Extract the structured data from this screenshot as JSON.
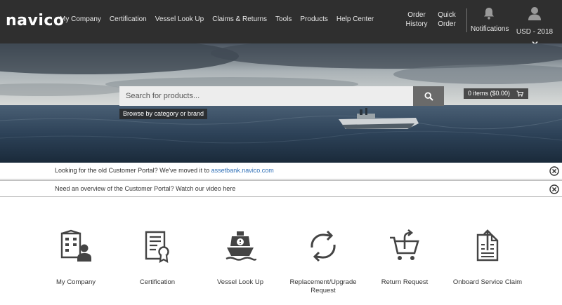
{
  "header": {
    "logo": "navico",
    "nav": [
      "My Company",
      "Certification",
      "Vessel Look Up",
      "Claims & Returns",
      "Tools",
      "Products",
      "Help Center"
    ],
    "order_history": "Order History",
    "quick_order": "Quick Order",
    "notifications": "Notifications",
    "currency": "USD - 2018"
  },
  "hero": {
    "cart": "0 items ($0.00)",
    "search_placeholder": "Search for products...",
    "browse": "Browse by category or brand"
  },
  "banners": {
    "first_text": "Looking for the old Customer Portal? We've moved it to ",
    "first_link": "assetbank.navico.com",
    "second_text": "Need an overview of the Customer Portal? Watch our video here"
  },
  "tiles": [
    {
      "label": "My Company",
      "icon": "building-user-icon"
    },
    {
      "label": "Certification",
      "icon": "certificate-icon"
    },
    {
      "label": "Vessel Look Up",
      "icon": "vessel-icon"
    },
    {
      "label": "Replacement/Upgrade Request",
      "icon": "refresh-icon"
    },
    {
      "label": "Return Request",
      "icon": "cart-return-icon"
    },
    {
      "label": "Onboard Service Claim",
      "icon": "service-document-icon"
    }
  ],
  "colors": {
    "nav_bg": "#2f2f2f",
    "link": "#2e6fb7",
    "icon": "#444444"
  }
}
